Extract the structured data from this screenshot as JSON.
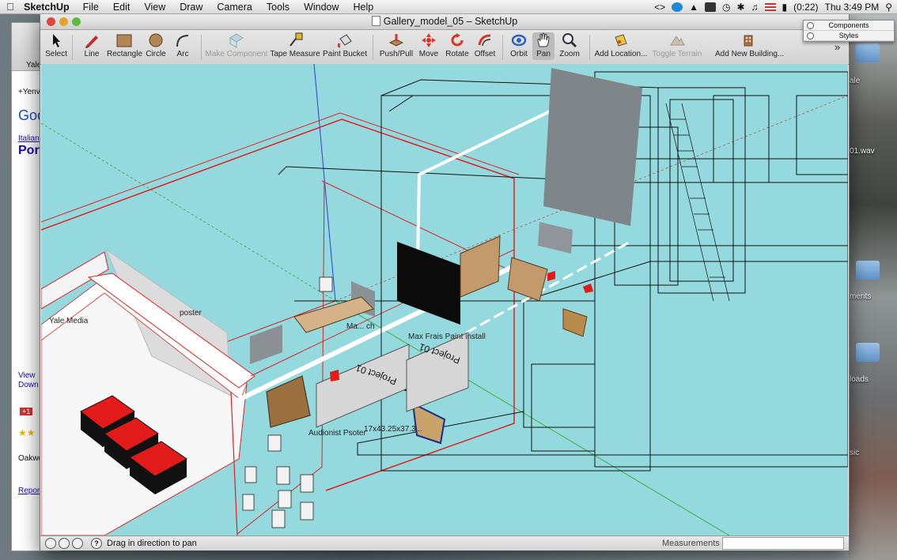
{
  "menubar": {
    "app_name": "SketchUp",
    "items": [
      "File",
      "Edit",
      "View",
      "Draw",
      "Camera",
      "Tools",
      "Window",
      "Help"
    ],
    "status": {
      "battery": "(0:22)",
      "clock": "Thu 3:49 PM",
      "code_icon": "<>"
    }
  },
  "desktop": {
    "labels": [
      "ale",
      "01.wav",
      "ments",
      "loads",
      "sic"
    ]
  },
  "browser": {
    "tab": "Yale",
    "bookmark": "+Yenv",
    "logo": "Goo",
    "link1": "Italian",
    "heading": "Por",
    "view": "View",
    "down": "Down",
    "plus": "+1",
    "place": "Oakwo",
    "report": "Report"
  },
  "window": {
    "title": "Gallery_model_05 – SketchUp"
  },
  "toolbar": {
    "tools": [
      {
        "label": "Select",
        "icon": "select-arrow-icon"
      },
      {
        "label": "Line",
        "icon": "pencil-icon"
      },
      {
        "label": "Rectangle",
        "icon": "rectangle-icon"
      },
      {
        "label": "Circle",
        "icon": "circle-icon"
      },
      {
        "label": "Arc",
        "icon": "arc-icon"
      },
      {
        "label": "Make Component",
        "icon": "component-icon",
        "disabled": true
      },
      {
        "label": "Tape Measure",
        "icon": "tape-measure-icon"
      },
      {
        "label": "Paint Bucket",
        "icon": "paint-bucket-icon"
      },
      {
        "label": "Push/Pull",
        "icon": "push-pull-icon"
      },
      {
        "label": "Move",
        "icon": "move-icon"
      },
      {
        "label": "Rotate",
        "icon": "rotate-icon"
      },
      {
        "label": "Offset",
        "icon": "offset-icon"
      },
      {
        "label": "Orbit",
        "icon": "orbit-icon"
      },
      {
        "label": "Pan",
        "icon": "pan-hand-icon",
        "active": true
      },
      {
        "label": "Zoom",
        "icon": "zoom-icon"
      },
      {
        "label": "Add Location...",
        "icon": "add-location-icon"
      },
      {
        "label": "Toggle Terrain",
        "icon": "toggle-terrain-icon",
        "disabled": true
      },
      {
        "label": "Add New Building...",
        "icon": "add-building-icon"
      }
    ],
    "overflow": "»"
  },
  "palettes": {
    "items": [
      "Components",
      "Styles"
    ]
  },
  "model_labels": {
    "yale_media": "Yale Media",
    "poster": "poster",
    "max_frais": "Max Frais Paint install",
    "max_bench": "Ma... ch",
    "audionist": "Audionist Psoter",
    "dimensions": "17x43.25x37.3...",
    "project01a": "Project 01",
    "project01b": "Project 01"
  },
  "statusbar": {
    "hint": "Drag in direction to pan",
    "measurements_label": "Measurements",
    "measurements_value": ""
  }
}
